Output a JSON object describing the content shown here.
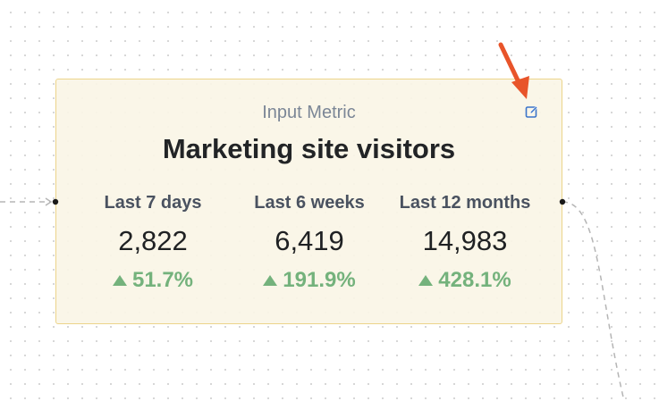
{
  "node": {
    "kind": "Input Metric",
    "title": "Marketing site visitors",
    "edit_icon": "edit-icon"
  },
  "metrics": [
    {
      "label": "Last 7 days",
      "value": "2,822",
      "change": "51.7%",
      "direction": "up"
    },
    {
      "label": "Last 6 weeks",
      "value": "6,419",
      "change": "191.9%",
      "direction": "up"
    },
    {
      "label": "Last 12 months",
      "value": "14,983",
      "change": "428.1%",
      "direction": "up"
    }
  ],
  "colors": {
    "card_bg": "#faf5e6",
    "card_border": "#ecd48a",
    "positive": "#74b27c",
    "edit_icon": "#3b74c9",
    "annotation_arrow": "#e8542a",
    "edge": "#b5b5b5"
  }
}
